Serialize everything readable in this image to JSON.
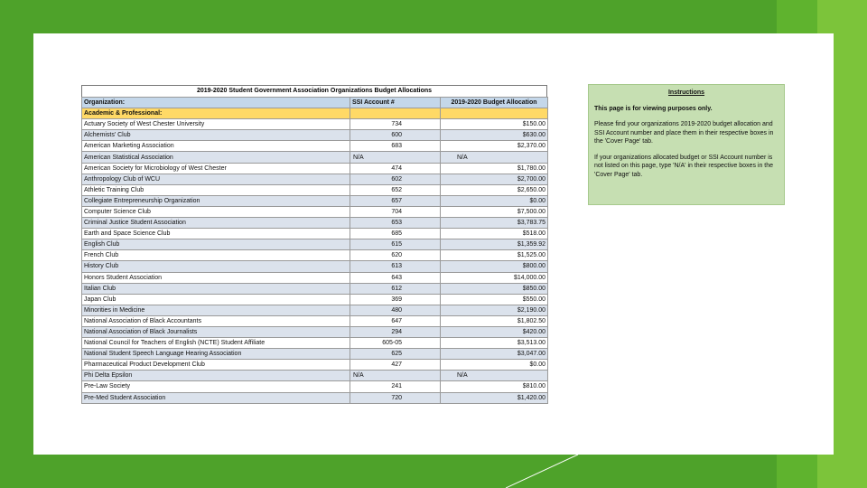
{
  "colors": {
    "background": "#4ea22a",
    "stripe_light": "#7cc43a",
    "header_blue": "#c4d7ea",
    "section_yellow": "#ffd966",
    "row_alt": "#dbe2ec",
    "instructions_bg": "#c6dfb2"
  },
  "table": {
    "title": "2019-2020 Student Government Association Organizations Budget Allocations",
    "header": {
      "organization": "Organization:",
      "account": "SSI Account #",
      "allocation": "2019-2020 Budget Allocation"
    },
    "section_label": "Academic & Professional:",
    "rows": [
      {
        "org": "Actuary Society of West Chester University",
        "acct": "734",
        "alloc": "$150.00"
      },
      {
        "org": "Alchemists' Club",
        "acct": "600",
        "alloc": "$630.00"
      },
      {
        "org": "American Marketing Association",
        "acct": "683",
        "alloc": "$2,370.00"
      },
      {
        "org": "American Statistical Association",
        "acct": "N/A",
        "alloc": "N/A"
      },
      {
        "org": "American Society for Microbiology of West Chester",
        "acct": "474",
        "alloc": "$1,780.00"
      },
      {
        "org": "Anthropology Club of WCU",
        "acct": "602",
        "alloc": "$2,700.00"
      },
      {
        "org": "Athletic Training Club",
        "acct": "652",
        "alloc": "$2,650.00"
      },
      {
        "org": "Collegiate Entrepreneurship Organization",
        "acct": "657",
        "alloc": "$0.00"
      },
      {
        "org": "Computer Science Club",
        "acct": "704",
        "alloc": "$7,500.00"
      },
      {
        "org": "Criminal Justice Student Association",
        "acct": "653",
        "alloc": "$3,783.75"
      },
      {
        "org": "Earth and Space Science Club",
        "acct": "685",
        "alloc": "$518.00"
      },
      {
        "org": "English Club",
        "acct": "615",
        "alloc": "$1,359.92"
      },
      {
        "org": "French Club",
        "acct": "620",
        "alloc": "$1,525.00"
      },
      {
        "org": "History Club",
        "acct": "613",
        "alloc": "$800.00"
      },
      {
        "org": "Honors Student Association",
        "acct": "643",
        "alloc": "$14,000.00"
      },
      {
        "org": "Italian Club",
        "acct": "612",
        "alloc": "$850.00"
      },
      {
        "org": "Japan Club",
        "acct": "369",
        "alloc": "$550.00"
      },
      {
        "org": "Minorities in Medicine",
        "acct": "480",
        "alloc": "$2,190.00"
      },
      {
        "org": "National Association of Black Accountants",
        "acct": "647",
        "alloc": "$1,802.50"
      },
      {
        "org": "National Association of Black Journalists",
        "acct": "294",
        "alloc": "$420.00"
      },
      {
        "org": "National Council for Teachers of English (NCTE) Student Affiliate",
        "acct": "605-05",
        "alloc": "$3,513.00"
      },
      {
        "org": "National Student Speech Language Hearing Association",
        "acct": "625",
        "alloc": "$3,047.00"
      },
      {
        "org": "Pharmaceutical Product Development Club",
        "acct": "427",
        "alloc": "$0.00"
      },
      {
        "org": "Phi Delta Epsilon",
        "acct": "N/A",
        "alloc": "N/A"
      },
      {
        "org": "Pre-Law Society",
        "acct": "241",
        "alloc": "$810.00"
      },
      {
        "org": "Pre-Med Student Association",
        "acct": "720",
        "alloc": "$1,420.00"
      }
    ]
  },
  "instructions": {
    "title": "Instructions",
    "p1": "This page is for viewing purposes only.",
    "p2": "Please find your organizations 2019-2020 budget allocation and SSI Account number and place them in their respective boxes in the 'Cover Page' tab.",
    "p3": "If your organizations allocated budget or SSI Account number is not listed on this page, type 'N/A' in their respective boxes in the 'Cover Page' tab."
  }
}
